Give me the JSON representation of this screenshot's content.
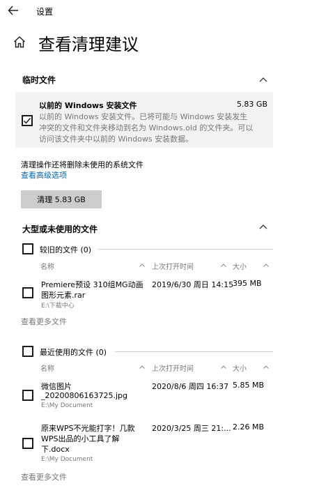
{
  "window": {
    "back_icon": "back-arrow-icon",
    "title": "设置"
  },
  "header": {
    "home_icon": "home-icon",
    "title": "查看清理建议"
  },
  "temp_files": {
    "title": "临时文件",
    "item": {
      "name": "以前的 Windows 安装文件",
      "size": "5.83 GB",
      "desc_lines": [
        "以前的 Windows 安装文件。已将可能与 Windows 安装发生",
        "冲突的文件和文件夹移动到名为 Windows.old 的文件夹。可以",
        "访问该文件夹中以前的 Windows 安装数据。"
      ],
      "checked": true
    }
  },
  "note": "清理操作还将删除未使用的系统文件",
  "advanced_link": "查看高级选项",
  "cleanup_button": "清理 5.83 GB",
  "large_files": {
    "title": "大型或未使用的文件",
    "groups": [
      {
        "label": "较旧的文件 (0)",
        "columns": [
          "名称",
          "上次打开时间",
          "大小"
        ],
        "files": [
          {
            "name_lines": [
              "Premiere预设 310组MG动画",
              "图形元素.rar"
            ],
            "path": "E:\\下载中心",
            "date": "2019/6/30 周日 14:15",
            "size": "395 MB"
          }
        ],
        "more": "查看更多文件"
      },
      {
        "label": "最近使用的文件 (0)",
        "columns": [
          "名称",
          "上次打开时间",
          "大小"
        ],
        "files": [
          {
            "name_lines": [
              "微信图片",
              "_20200806163725.jpg"
            ],
            "path": "E:\\My Document",
            "date": "2020/8/6 周四 16:37",
            "size": "5.85 MB"
          },
          {
            "name_lines": [
              "原来WPS不光能打字！几款",
              "WPS出品的小工具了解",
              "下.docx"
            ],
            "path": "E:\\My Document",
            "date": "2020/3/25 周三 21:...",
            "size": "2.26 MB"
          }
        ],
        "more": "查看更多文件"
      }
    ]
  }
}
